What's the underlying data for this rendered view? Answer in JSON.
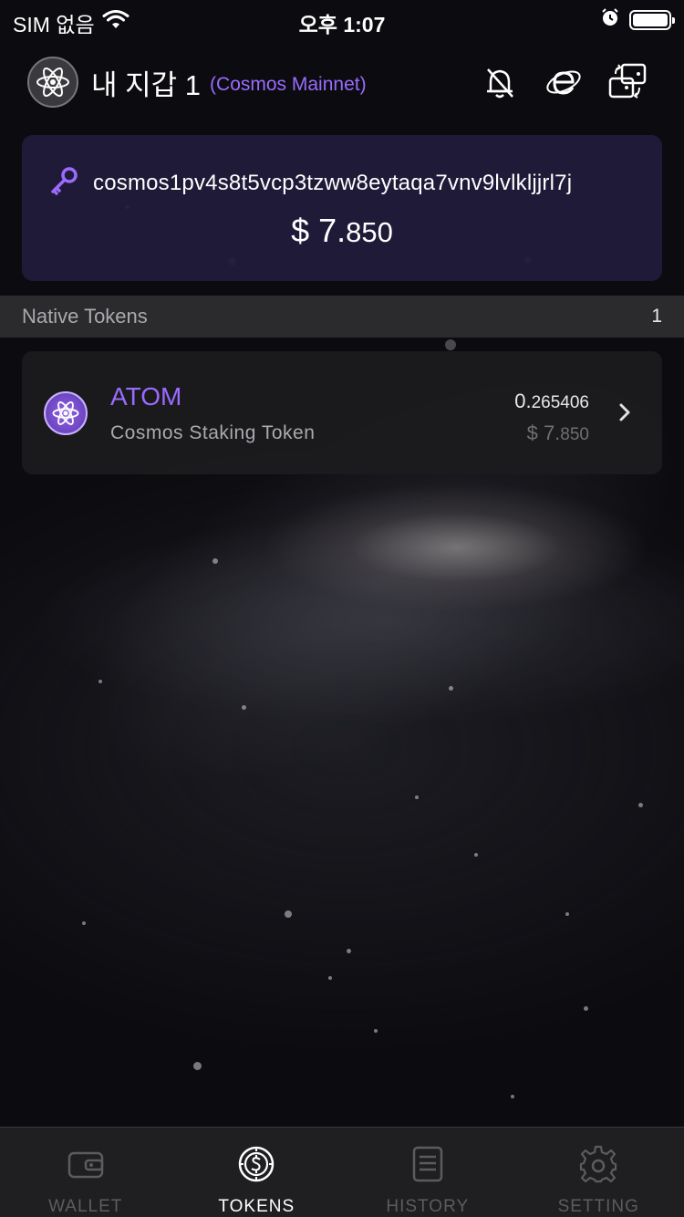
{
  "status_bar": {
    "carrier": "SIM 없음",
    "time": "오후 1:07"
  },
  "header": {
    "wallet_name": "내 지갑 1",
    "network": "(Cosmos Mainnet)"
  },
  "address_card": {
    "address": "cosmos1pv4s8t5vcp3tzww8eytaqa7vnv9lvlkljjrl7j",
    "total_value_int": "$ 7.",
    "total_value_dec": "850"
  },
  "section": {
    "title": "Native Tokens",
    "count": "1"
  },
  "tokens": [
    {
      "symbol": "ATOM",
      "name": "Cosmos Staking Token",
      "amount_int": "0.",
      "amount_dec": "265406",
      "value_int": "$ 7.",
      "value_dec": "850",
      "icon": "cosmos-atom-icon"
    }
  ],
  "tabs": [
    {
      "label": "WALLET",
      "icon": "wallet-icon",
      "active": false
    },
    {
      "label": "TOKENS",
      "icon": "coin-icon",
      "active": true
    },
    {
      "label": "HISTORY",
      "icon": "document-icon",
      "active": false
    },
    {
      "label": "SETTING",
      "icon": "gear-icon",
      "active": false
    }
  ],
  "colors": {
    "accent": "#9a6bff",
    "card": "#221c3c",
    "background": "#0c0c10"
  }
}
